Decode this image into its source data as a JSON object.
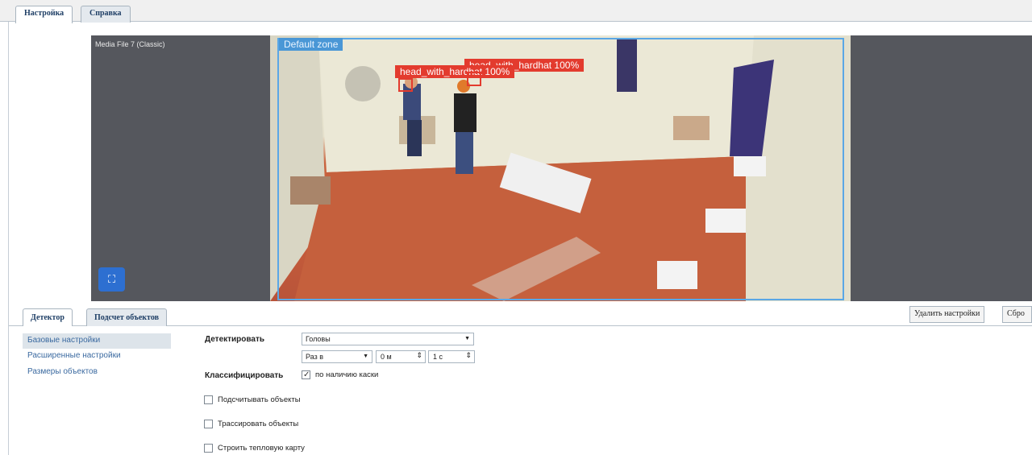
{
  "top_tabs": [
    {
      "label": "Настройка",
      "active": true
    },
    {
      "label": "Справка",
      "active": false
    }
  ],
  "viewer": {
    "file_label": "Media File 7 (Classic)",
    "zone_label": "Default zone",
    "top_text": "__________",
    "detections": [
      {
        "label": "head_with_hardhat  100%"
      },
      {
        "label": "head_with_hardhat  100%"
      }
    ],
    "fit_icon": "fit-to-screen-icon"
  },
  "bottom_tabs": [
    {
      "label": "Детектор",
      "active": true
    },
    {
      "label": "Подсчет объектов",
      "active": false
    }
  ],
  "actions": {
    "delete_settings": "Удалить настройки",
    "reset": "Сбро"
  },
  "menu": [
    {
      "label": "Базовые настройки",
      "selected": true
    },
    {
      "label": "Расширенные настройки",
      "selected": false
    },
    {
      "label": "Размеры объектов",
      "selected": false
    }
  ],
  "form": {
    "detect_label": "Детектировать",
    "detect_value": "Головы",
    "frequency_value": "Раз в",
    "minutes_value": "0 м",
    "seconds_value": "1 с",
    "classify_label": "Классифицировать",
    "classify_checkbox": {
      "label": "по наличию каски",
      "checked": true
    },
    "checkboxes": [
      {
        "label": "Подсчитывать объекты",
        "checked": false
      },
      {
        "label": "Трассировать объекты",
        "checked": false
      },
      {
        "label": "Строить тепловую карту",
        "checked": false
      }
    ]
  }
}
